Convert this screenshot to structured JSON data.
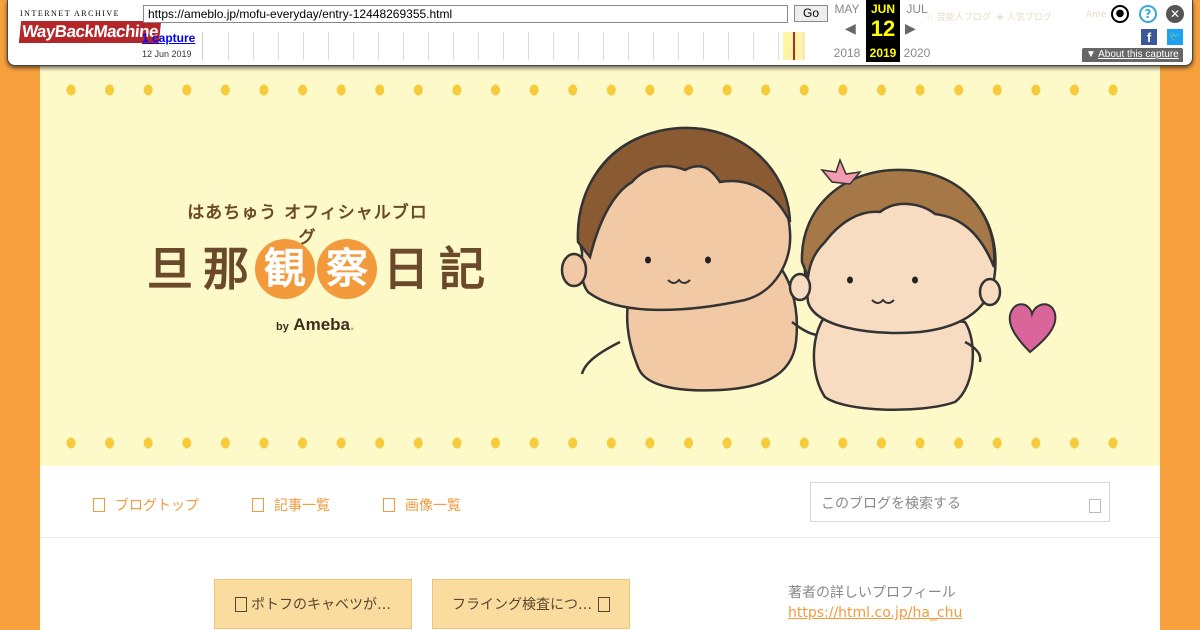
{
  "wayback": {
    "logo_top": "INTERNET ARCHIVE",
    "logo_main_1": "WayBack",
    "logo_main_2": "Machine",
    "url": "https://ameblo.jp/mofu-everyday/entry-12448269355.html",
    "go_label": "Go",
    "captures_label": "1 capture",
    "capture_date": "12 Jun 2019",
    "prev_month": "MAY",
    "cur_month": "JUN",
    "next_month": "JUL",
    "cur_day": "12",
    "prev_year": "2018",
    "cur_year": "2019",
    "next_year": "2020",
    "about_label": "About this capture",
    "ghost_1": "☆ 芸能人ブログ",
    "ghost_2": "★ 人気ブログ",
    "ghost_3": "Ame"
  },
  "banner": {
    "subtitle": "はあちゅう オフィシャルブログ",
    "title_chars": [
      "旦",
      "那",
      "観",
      "察",
      "日",
      "記"
    ],
    "by": "by",
    "ameba": "Ameba",
    "ameba_mark": ".",
    "colors": {
      "brown": "#6b4a2b",
      "orange": "#f39a3c",
      "yellow_bg": "#fef9c8",
      "dot": "#f7cb3e"
    }
  },
  "nav": {
    "items": [
      {
        "label": "ブログトップ"
      },
      {
        "label": "記事一覧"
      },
      {
        "label": "画像一覧"
      }
    ],
    "search_placeholder": "このブログを検索する"
  },
  "content": {
    "prev_entry": "ポトフのキャベツが…",
    "next_entry": "フライング検査につ…",
    "profile_label": "著者の詳しいプロフィール",
    "profile_url": "https://html.co.jp/ha_chu"
  }
}
